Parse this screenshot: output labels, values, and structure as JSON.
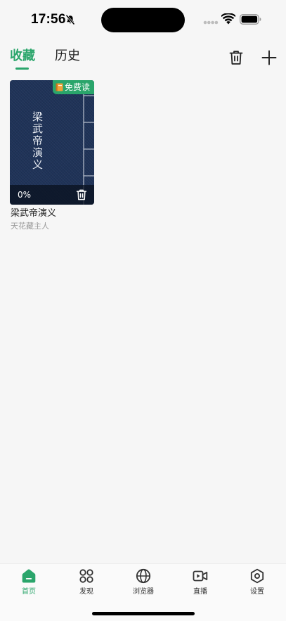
{
  "status_bar": {
    "time": "17:56"
  },
  "header": {
    "tabs": [
      {
        "label": "收藏",
        "active": true
      },
      {
        "label": "历史",
        "active": false
      }
    ]
  },
  "books": [
    {
      "cover_title": "梁武帝演义",
      "badge": "免费读",
      "progress": "0%",
      "title": "梁武帝演义",
      "author": "天花藏主人"
    }
  ],
  "bottom_nav": {
    "items": [
      {
        "label": "首页",
        "icon": "home-icon",
        "active": true
      },
      {
        "label": "发现",
        "icon": "discover-grid-icon",
        "active": false
      },
      {
        "label": "浏览器",
        "icon": "globe-icon",
        "active": false
      },
      {
        "label": "直播",
        "icon": "video-camera-icon",
        "active": false
      },
      {
        "label": "设置",
        "icon": "settings-hexagon-icon",
        "active": false
      }
    ]
  },
  "colors": {
    "accent": "#2aa56b",
    "cover": "#1f3358",
    "background": "#f6f6f6"
  }
}
